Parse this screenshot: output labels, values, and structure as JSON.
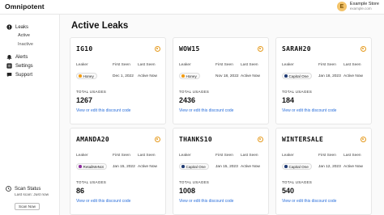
{
  "app": {
    "name": "Omnipotent"
  },
  "store": {
    "avatar_letter": "E",
    "name": "Example Store",
    "url": "example.com"
  },
  "sidebar": {
    "leaks": "Leaks",
    "active": "Active",
    "inactive": "Inactive",
    "alerts": "Alerts",
    "settings": "Settings",
    "support": "Support"
  },
  "scan": {
    "title": "Scan Status",
    "last": "Last scan: Just now",
    "button": "Scan Now"
  },
  "page": {
    "title": "Active Leaks"
  },
  "labels": {
    "leaker": "Leaker",
    "first_seen": "First Seen",
    "last_seen": "Last Seen",
    "total_usages": "TOTAL USAGES",
    "link": "View or edit this discount code"
  },
  "colors": {
    "Honey": "#f39c12",
    "Capital One": "#1f3a73",
    "RetailMeNot": "#8e2b9e",
    "link": "#2a6fdb",
    "status": "#e59a1d"
  },
  "cards": [
    {
      "code": "IG10",
      "leaker": "Honey",
      "first_seen": "Dec 1, 2022",
      "last_seen": "Active Now",
      "usages": "1267"
    },
    {
      "code": "WOW15",
      "leaker": "Honey",
      "first_seen": "Nov 18, 2022",
      "last_seen": "Active Now",
      "usages": "2436"
    },
    {
      "code": "SARAH20",
      "leaker": "Capital One",
      "first_seen": "Jan 18, 2023",
      "last_seen": "Active Now",
      "usages": "184"
    },
    {
      "code": "AMANDA20",
      "leaker": "RetailMeNot",
      "first_seen": "Jan 15, 2022",
      "last_seen": "Active Now",
      "usages": "86"
    },
    {
      "code": "THANKS10",
      "leaker": "Capital One",
      "first_seen": "Jan 15, 2023",
      "last_seen": "Active Now",
      "usages": "1008"
    },
    {
      "code": "WINTERSALE",
      "leaker": "Capital One",
      "first_seen": "Jan 12, 2023",
      "last_seen": "Active Now",
      "usages": "540"
    }
  ]
}
